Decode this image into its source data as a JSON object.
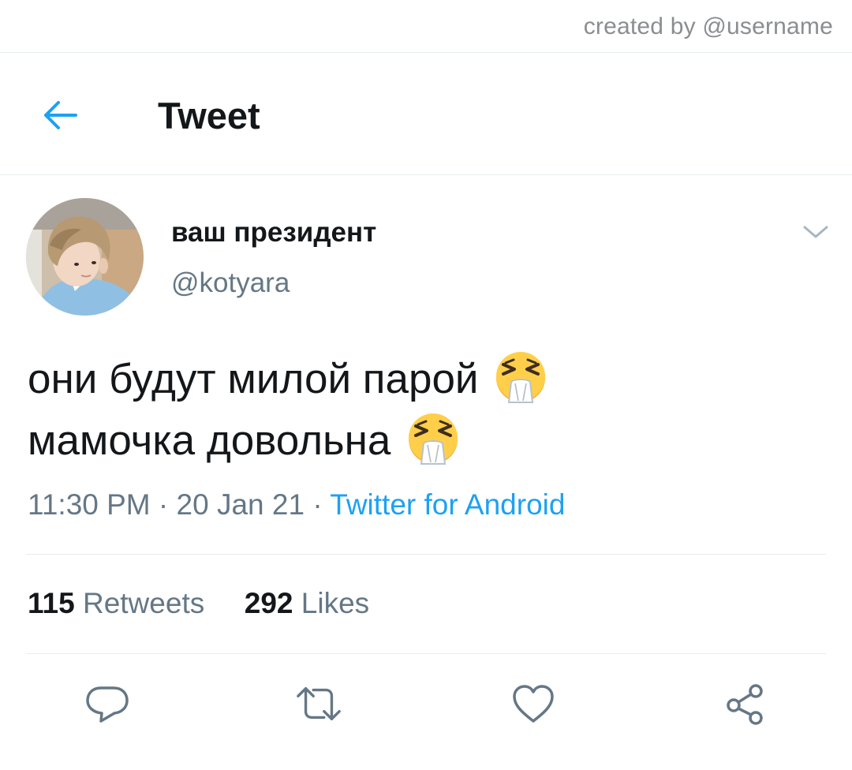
{
  "credit": {
    "text": "created by @username"
  },
  "header": {
    "title": "Tweet"
  },
  "tweet": {
    "author": {
      "display_name": "ваш президент",
      "handle": "@kotyara"
    },
    "lines": [
      "они будут милой парой",
      "мамочка довольна"
    ],
    "time": "11:30 PM",
    "date": "20 Jan 21",
    "separator": " · ",
    "source": "Twitter for Android",
    "retweets": {
      "count": "115",
      "label": "Retweets"
    },
    "likes": {
      "count": "292",
      "label": "Likes"
    }
  },
  "icons": {
    "back": "arrow-left-icon",
    "caret": "chevron-down-icon",
    "reply": "reply-icon",
    "retweet": "retweet-icon",
    "like": "heart-icon",
    "share": "share-icon",
    "emoji": "sneezing-face-emoji"
  },
  "colors": {
    "accent": "#1da1f2",
    "secondary_text": "#657786",
    "primary_text": "#14171a",
    "divider": "#e6ecf0"
  }
}
